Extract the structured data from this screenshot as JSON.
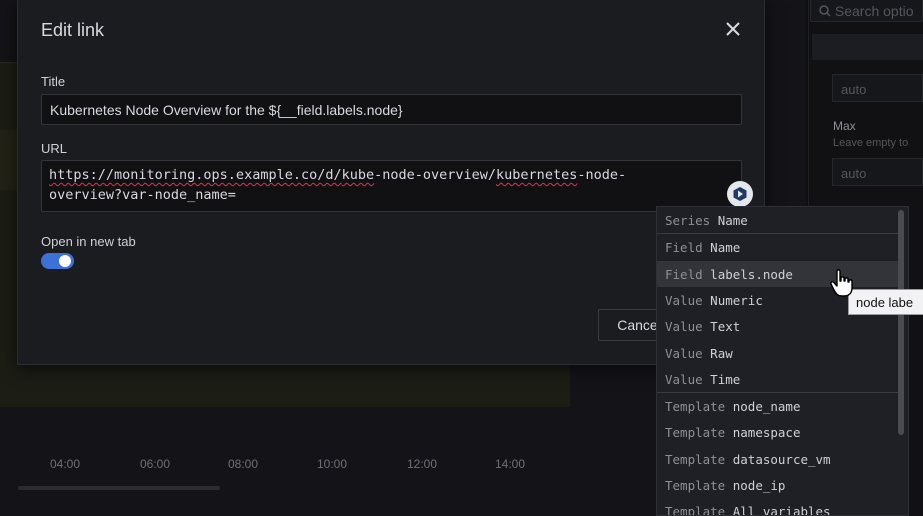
{
  "background": {
    "time_ticks": [
      "04:00",
      "06:00",
      "08:00",
      "10:00",
      "12:00",
      "14:00"
    ],
    "options_pane": {
      "search_placeholder": "Search optio",
      "auto_value_1": "auto",
      "max_label": "Max",
      "max_hint": "Leave empty to",
      "auto_value_2": "auto"
    }
  },
  "modal": {
    "title": "Edit link",
    "title_field": {
      "label": "Title",
      "value": "Kubernetes Node Overview for the ${__field.labels.node}"
    },
    "url_field": {
      "label": "URL",
      "line1_prefix": "https://monitoring.ops.example.co/d/",
      "line1_word1": "kube",
      "line1_mid": "-node-overview/",
      "line1_word2": "kubernetes",
      "line1_suffix": "-node-",
      "line2": "overview?var-node_name="
    },
    "open_new_tab": {
      "label": "Open in new tab",
      "checked": true
    },
    "cancel_label": "Cancel"
  },
  "suggestions": [
    {
      "kind": "Series",
      "name": "Name",
      "group_end": true,
      "active": false
    },
    {
      "kind": "Field",
      "name": "Name",
      "group_end": false,
      "active": false
    },
    {
      "kind": "Field",
      "name": "labels.node",
      "group_end": false,
      "active": true
    },
    {
      "kind": "Value",
      "name": "Numeric",
      "group_end": false,
      "active": false
    },
    {
      "kind": "Value",
      "name": "Text",
      "group_end": false,
      "active": false
    },
    {
      "kind": "Value",
      "name": "Raw",
      "group_end": false,
      "active": false
    },
    {
      "kind": "Value",
      "name": "Time",
      "group_end": true,
      "active": false
    },
    {
      "kind": "Template",
      "name": "node_name",
      "group_end": false,
      "active": false
    },
    {
      "kind": "Template",
      "name": "namespace",
      "group_end": false,
      "active": false
    },
    {
      "kind": "Template",
      "name": "datasource_vm",
      "group_end": false,
      "active": false
    },
    {
      "kind": "Template",
      "name": "node_ip",
      "group_end": false,
      "active": false
    },
    {
      "kind": "Template",
      "name": "All variables",
      "group_end": false,
      "active": false
    }
  ],
  "tooltip": "node labe",
  "colors": {
    "accent": "#3d71d9",
    "spellcheck": "#e0334a"
  }
}
